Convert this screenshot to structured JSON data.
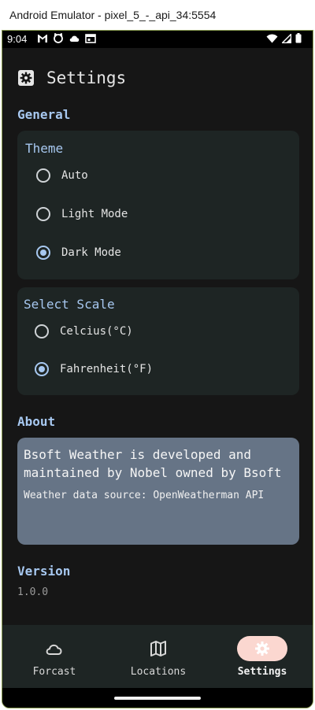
{
  "window": {
    "title": "Android Emulator - pixel_5_-_api_34:5554"
  },
  "status_bar": {
    "time": "9:04",
    "left_icons": [
      "gmail-icon",
      "cat-face-icon",
      "cloud-icon",
      "calendar-icon"
    ],
    "right_icons": [
      "wifi-icon",
      "signal-icon",
      "battery-icon"
    ]
  },
  "header": {
    "icon": "gear-icon",
    "title": "Settings"
  },
  "general": {
    "label": "General",
    "theme": {
      "title": "Theme",
      "options": [
        "Auto",
        "Light Mode",
        "Dark Mode"
      ],
      "selected": "Dark Mode"
    },
    "scale": {
      "title": "Select Scale",
      "options": [
        "Celcius(°C)",
        "Fahrenheit(°F)"
      ],
      "selected": "Fahrenheit(°F)"
    }
  },
  "about": {
    "label": "About",
    "text": "Bsoft Weather is developed and maintained by Nobel owned by Bsoft",
    "data_source": "Weather data source: OpenWeatherman API"
  },
  "version": {
    "label": "Version",
    "value": "1.0.0"
  },
  "bottom_nav": {
    "items": [
      {
        "label": "Forcast",
        "icon": "cloud-icon"
      },
      {
        "label": "Locations",
        "icon": "map-icon"
      },
      {
        "label": "Settings",
        "icon": "gear-icon"
      }
    ],
    "active": "Settings"
  },
  "colors": {
    "accent": "#a7c8f0",
    "background": "#161616",
    "card": "#1e2524",
    "about_card": "#667486",
    "active_nav_pill": "#fbd7d0"
  }
}
